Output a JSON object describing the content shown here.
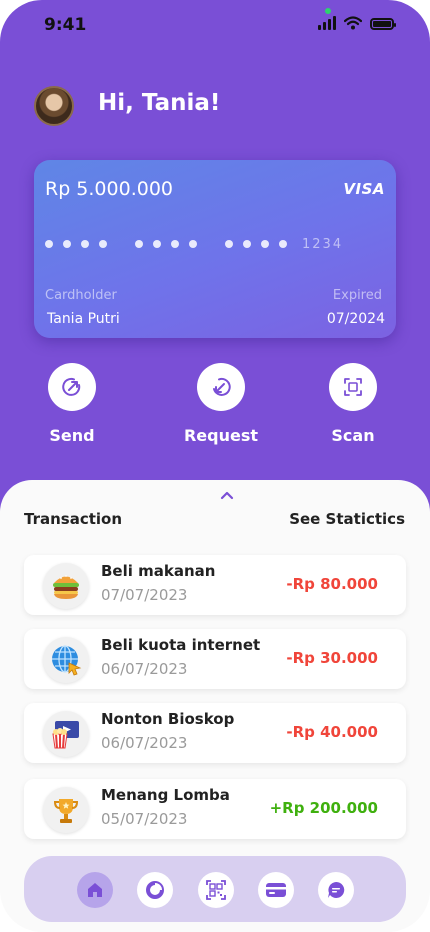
{
  "status_bar": {
    "time": "9:41"
  },
  "header": {
    "greeting": "Hi, Tania!"
  },
  "card": {
    "balance": "Rp 5.000.000",
    "brand": "VISA",
    "last_digits": "1234",
    "cardholder_label": "Cardholder",
    "cardholder_name": "Tania Putri",
    "expired_label": "Expired",
    "expired_value": "07/2024"
  },
  "actions": [
    {
      "label": "Send",
      "icon": "send-icon"
    },
    {
      "label": "Request",
      "icon": "request-icon"
    },
    {
      "label": "Scan",
      "icon": "scan-icon"
    }
  ],
  "transactions_section": {
    "title": "Transaction",
    "link": "See Statictics"
  },
  "transactions": [
    {
      "name": "Beli makanan",
      "date": "07/07/2023",
      "amount": "-Rp 80.000",
      "icon": "burger-icon",
      "amount_color": "#f0453a"
    },
    {
      "name": "Beli kuota internet",
      "date": "06/07/2023",
      "amount": "-Rp 30.000",
      "icon": "globe-icon",
      "amount_color": "#f0453a"
    },
    {
      "name": "Nonton Bioskop",
      "date": "06/07/2023",
      "amount": "-Rp 40.000",
      "icon": "cinema-icon",
      "amount_color": "#f0453a"
    },
    {
      "name": "Menang Lomba",
      "date": "05/07/2023",
      "amount": "+Rp 200.000",
      "icon": "trophy-icon",
      "amount_color": "#3fb00e"
    }
  ],
  "bottom_nav": [
    {
      "icon": "home-icon",
      "active": true
    },
    {
      "icon": "chart-icon",
      "active": false
    },
    {
      "icon": "qr-icon",
      "active": false
    },
    {
      "icon": "card-icon",
      "active": false
    },
    {
      "icon": "chat-icon",
      "active": false
    }
  ],
  "colors": {
    "primary": "#7a4fd6",
    "debit": "#f0453a",
    "credit": "#3fb00e",
    "nav_bg": "#d8cff0"
  }
}
